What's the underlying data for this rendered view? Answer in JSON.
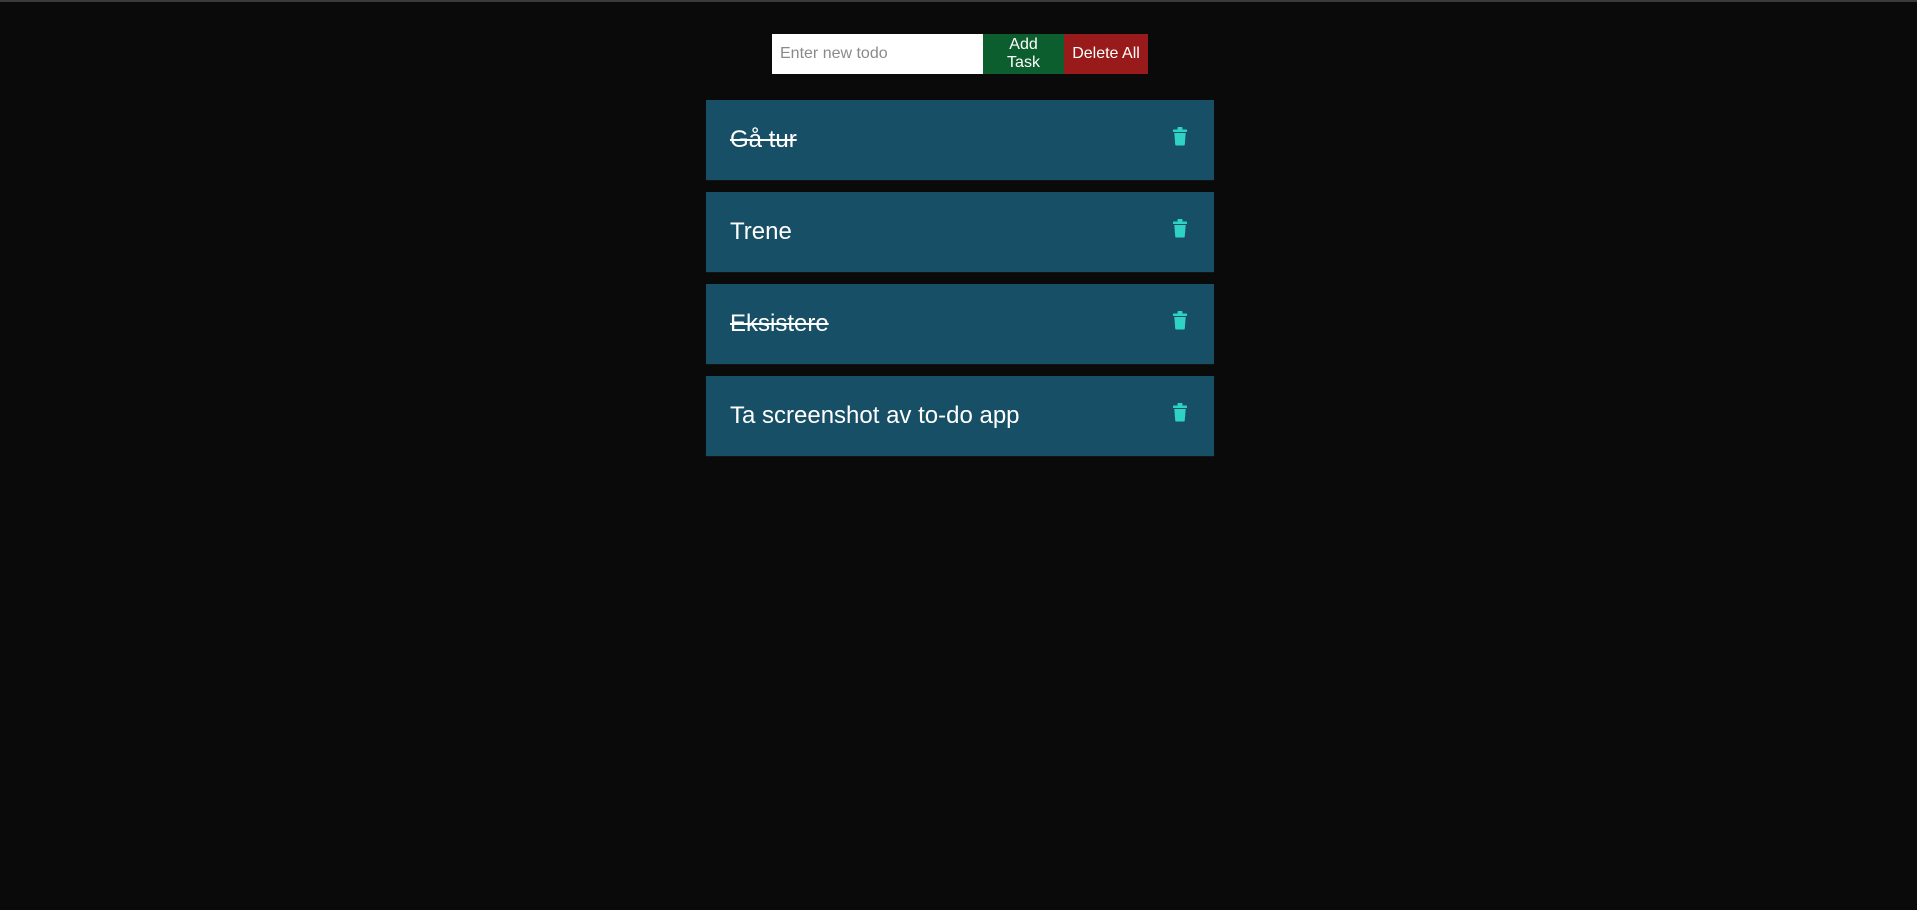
{
  "todo_form": {
    "input_value": "",
    "input_placeholder": "Enter new todo",
    "add_label": "Add Task",
    "delete_all_label": "Delete All"
  },
  "todos": [
    {
      "text": "Gå tur",
      "completed": true
    },
    {
      "text": "Trene",
      "completed": false
    },
    {
      "text": "Eksistere",
      "completed": true
    },
    {
      "text": "Ta screenshot av to-do app",
      "completed": false
    }
  ],
  "icons": {
    "delete_item": "trash-icon"
  },
  "colors": {
    "background": "#0a0a0a",
    "item_background": "#175066",
    "icon": "#2ed3c6",
    "add_button": "#0d5e2e",
    "delete_all_button": "#981a1a",
    "text": "#ffffff"
  }
}
